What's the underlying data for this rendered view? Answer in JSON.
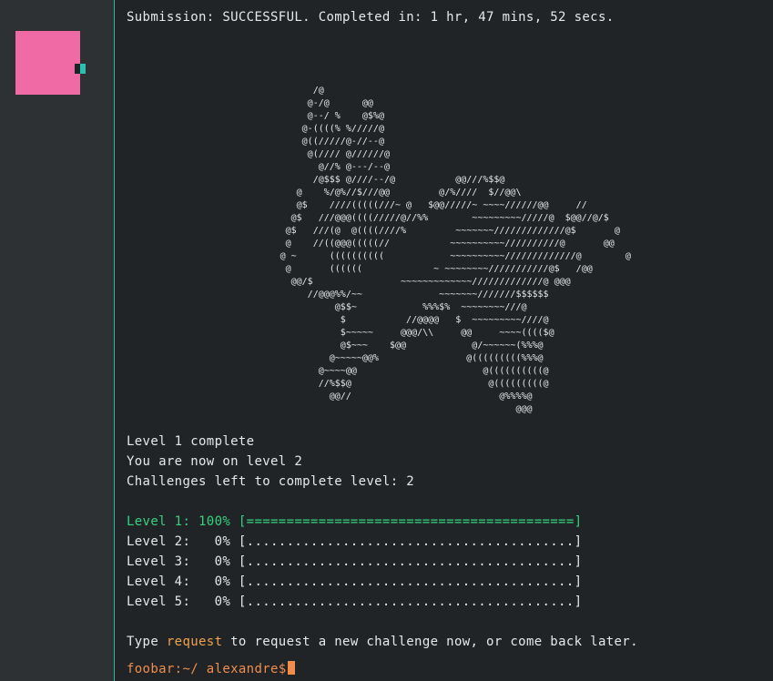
{
  "submission": "Submission: SUCCESSFUL. Completed in: 1 hr, 47 mins, 52 secs.",
  "ascii_art": "                                  /@\n                                 @-/@      @@\n                                 @--/ %    @$%@\n                                @-((((% %/////@\n                                @((/////@-//--@\n                                 @(//// @//////@\n                                   @//% @---/--@\n                                  /@$$$ @////--/@           @@///%$$@\n                               @    %/@%//$///@@         @/%////  $//@@\\\n                               @$    ////(((((///~ @   $@@/////~ ~~~~//////@@     //\n                              @$   ///@@@((((/////@//%%        ~~~~~~~~~/////@  $@@//@/$\n                             @$   ///(@  @((((////%         ~~~~~~~/////////////@$       @\n                             @    //((@@@(((((//           ~~~~~~~~~~//////////@       @@\n                            @ ~      ((((((((((            ~~~~~~~~~~/////////////@        @\n                             @       ((((((             ~ ~~~~~~~~///////////@$   /@@\n                              @@/$                ~~~~~~~~~~~~~/////////////@ @@@\n                                 //@@@%%/~~              ~~~~~~~///////$$$$$$\n                                      @$$~            %%%$%  ~~~~~~~~///@\n                                       $           //@@@@   $  ~~~~~~~~~////@\n                                       $~~~~~     @@@/\\\\     @@     ~~~~(((($@\n                                       @$~~~    $@@            @/~~~~~~(%%%@\n                                     @~~~~~@@%                @(((((((((%%%@\n                                   @~~~~@@                       @((((((((((@\n                                   //%$$@                         @(((((((((@\n                                     @@//                           @%%%%@\n                                                                       @@@",
  "level_complete": "Level 1 complete",
  "now_on_level": "You are now on level 2",
  "challenges_left": "Challenges left to complete level: 2",
  "levels": [
    "Level 1: 100% [=========================================]",
    "Level 2:   0% [.........................................]",
    "Level 3:   0% [.........................................]",
    "Level 4:   0% [.........................................]",
    "Level 5:   0% [.........................................]"
  ],
  "instruction": {
    "prefix": "Type ",
    "command": "request",
    "suffix": " to request a new challenge now, or come back later."
  },
  "prompt": "foobar:~/ alexandre$",
  "colors": {
    "background": "#202427",
    "sidebar": "#2d3133",
    "accent_border": "#2fb3ad",
    "avatar": "#f06aa6",
    "level_complete_green": "#35d37f",
    "command_orange": "#f0a34a",
    "prompt_orange": "#f08d4d"
  }
}
